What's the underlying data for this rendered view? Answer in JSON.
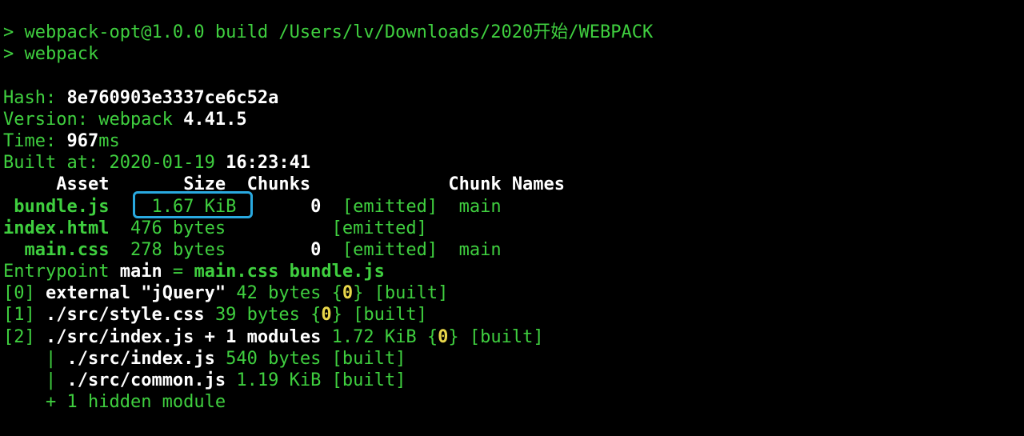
{
  "cmd": {
    "prompt": "> ",
    "line1": "webpack-opt@1.0.0 build /Users/lv/Downloads/2020开始/WEBPACK",
    "line2": "webpack"
  },
  "info": {
    "hash_label": "Hash: ",
    "hash_value": "8e760903e3337ce6c52a",
    "version_label": "Version: webpack ",
    "version_value": "4.41.5",
    "time_label": "Time: ",
    "time_value": "967",
    "time_unit": "ms",
    "built_label": "Built at: 2020-01-19 ",
    "built_value": "16:23:41"
  },
  "table": {
    "headers": {
      "asset": "Asset",
      "size": "Size",
      "chunks": "Chunks",
      "chunk_names": "Chunk Names"
    },
    "rows": [
      {
        "asset": "bundle.js",
        "size": "1.67 KiB",
        "chunks": "0",
        "emitted": "[emitted]",
        "name": "main"
      },
      {
        "asset": "index.html",
        "size": "476 bytes",
        "chunks": "",
        "emitted": "[emitted]",
        "name": ""
      },
      {
        "asset": "main.css",
        "size": "278 bytes",
        "chunks": "0",
        "emitted": "[emitted]",
        "name": "main"
      }
    ]
  },
  "entrypoint": {
    "label": "Entrypoint ",
    "name": "main",
    "eq": " = ",
    "files": "main.css bundle.js"
  },
  "modules": [
    {
      "id": "[0]",
      "name": "external \"jQuery\"",
      "size": "42 bytes",
      "chunk": "0",
      "status": "[built]"
    },
    {
      "id": "[1]",
      "name": "./src/style.css",
      "size": "39 bytes",
      "chunk": "0",
      "status": "[built]"
    },
    {
      "id": "[2]",
      "name": "./src/index.js + 1 modules",
      "size": "1.72 KiB",
      "chunk": "0",
      "status": "[built]"
    }
  ],
  "submodules": [
    {
      "prefix": "|",
      "name": "./src/index.js",
      "size": "540 bytes",
      "status": "[built]"
    },
    {
      "prefix": "|",
      "name": "./src/common.js",
      "size": "1.19 KiB",
      "status": "[built]"
    }
  ],
  "hidden": "+ 1 hidden module",
  "highlight_color": "#29a9e0"
}
